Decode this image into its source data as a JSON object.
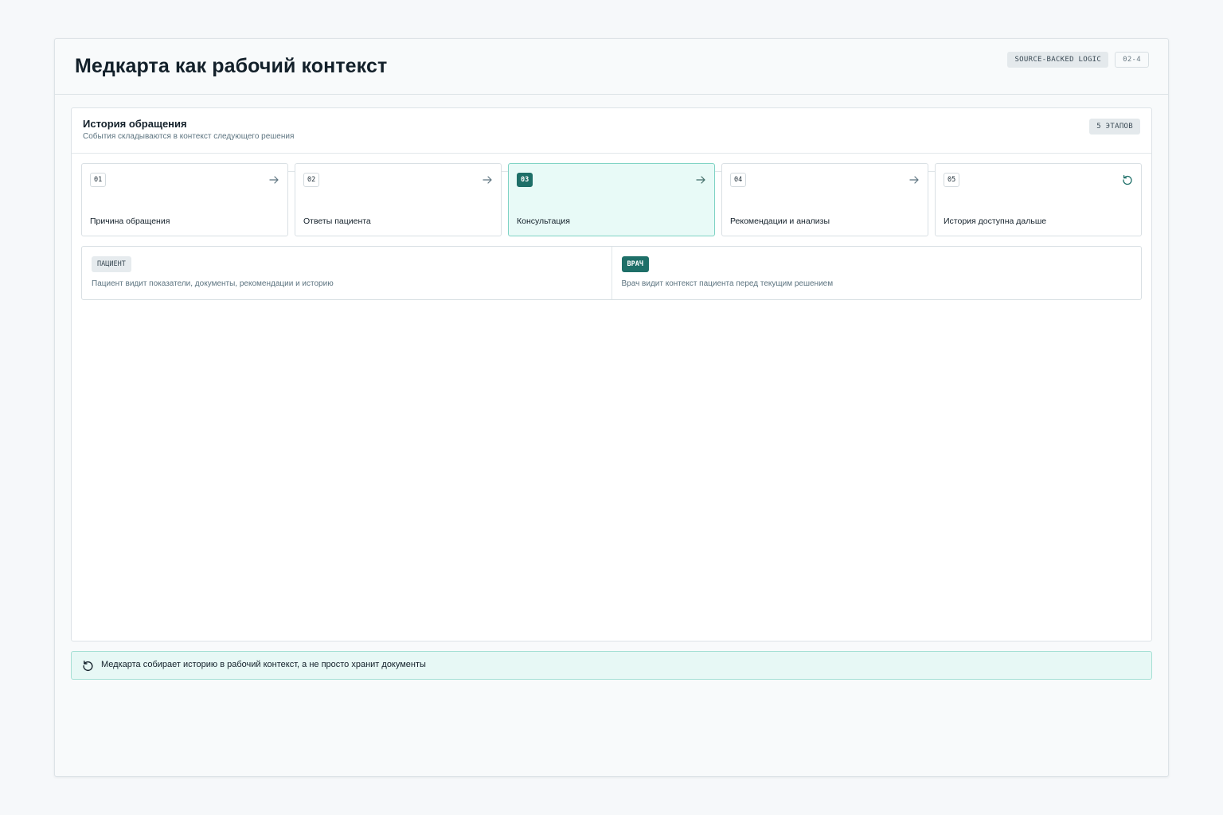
{
  "header": {
    "title": "Медкарта как рабочий контекст",
    "tag_source": "SOURCE-BACKED LOGIC",
    "tag_id": "02-4"
  },
  "history": {
    "title": "История обращения",
    "subtitle": "События складываются в контекст следующего решения",
    "count": "5 ЭТАПОВ",
    "stages": [
      {
        "num": "01",
        "label": "Причина обращения",
        "icon": "arrow-right-icon",
        "active": false
      },
      {
        "num": "02",
        "label": "Ответы пациента",
        "icon": "arrow-right-icon",
        "active": false
      },
      {
        "num": "03",
        "label": "Консультация",
        "icon": "arrow-right-icon",
        "active": true
      },
      {
        "num": "04",
        "label": "Рекомендации и анализы",
        "icon": "arrow-right-icon",
        "active": false
      },
      {
        "num": "05",
        "label": "История доступна дальше",
        "icon": "history-icon",
        "active": false
      }
    ]
  },
  "roles": {
    "patient": {
      "badge": "ПАЦИЕНТ",
      "text": "Пациент видит показатели, документы, рекомендации и историю"
    },
    "doctor": {
      "badge": "ВРАЧ",
      "text": "Врач видит контекст пациента перед текущим решением"
    }
  },
  "footer": {
    "icon": "history-icon",
    "text": "Медкарта собирает историю в рабочий контекст, а не просто хранит документы"
  },
  "colors": {
    "accent": "#1e6f68",
    "active_bg": "#e8faf7",
    "note_bg": "#e7f8f5"
  }
}
